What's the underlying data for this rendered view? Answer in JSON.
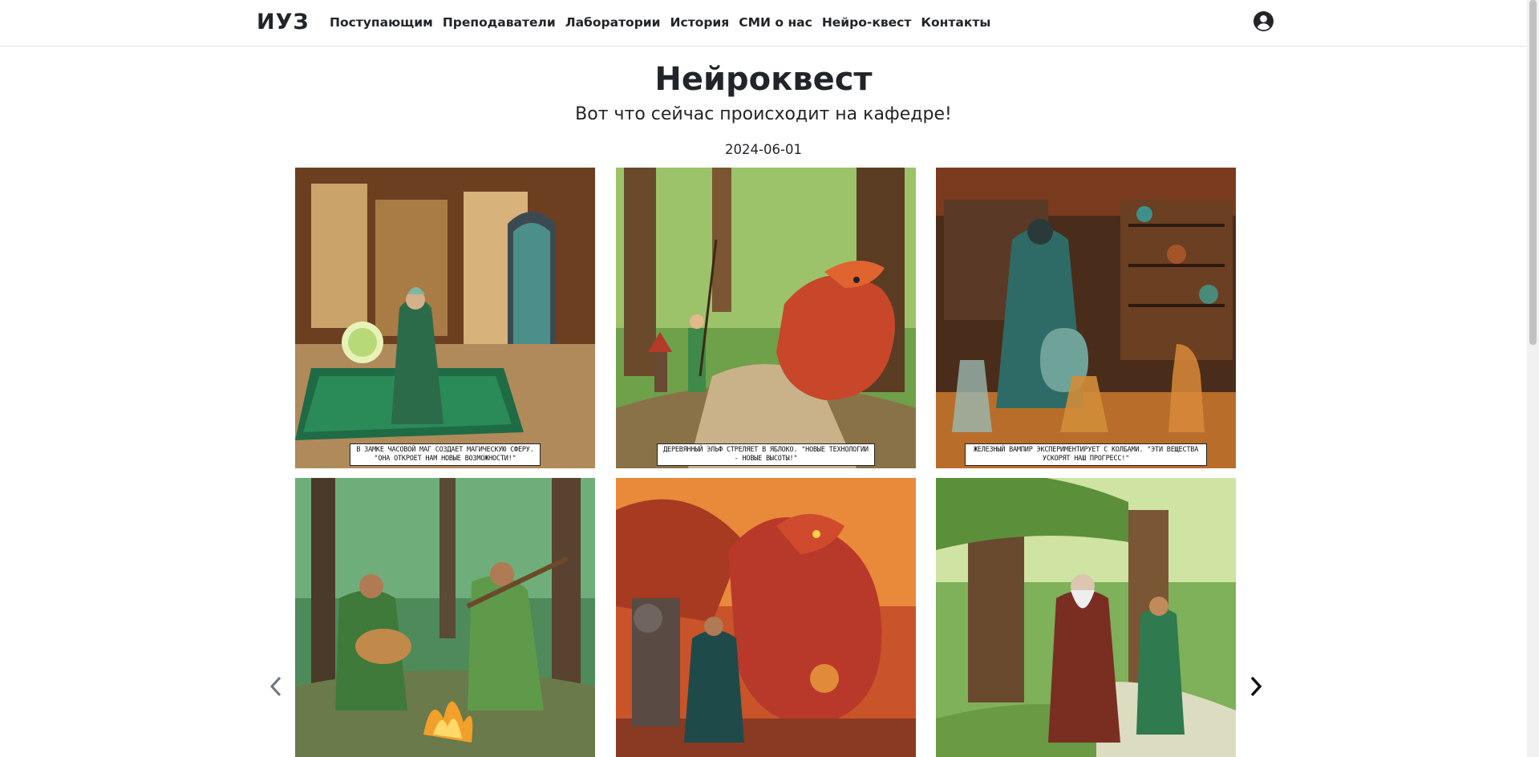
{
  "header": {
    "brand": "ИУЗ",
    "nav": [
      "Поступающим",
      "Преподаватели",
      "Лаборатории",
      "История",
      "СМИ о нас",
      "Нейро-квест",
      "Контакты"
    ]
  },
  "main": {
    "title": "Нейроквест",
    "subtitle": "Вот что сейчас происходит на кафедре!",
    "date": "2024-06-01"
  },
  "gallery": {
    "captions": [
      "В замке часовой маг создает магическую сферу. \"Она откроет нам новые возможности!\"",
      "Деревянный эльф стреляет в яблоко. \"Новые технологии - новые высоты!\"",
      "Железный вампир экспериментирует с колбами. \"Эти вещества ускорят наш прогресс!\""
    ],
    "prev_icon": "chevron-left-icon",
    "next_icon": "chevron-right-icon"
  },
  "icons": {
    "user": "user-circle-icon"
  }
}
